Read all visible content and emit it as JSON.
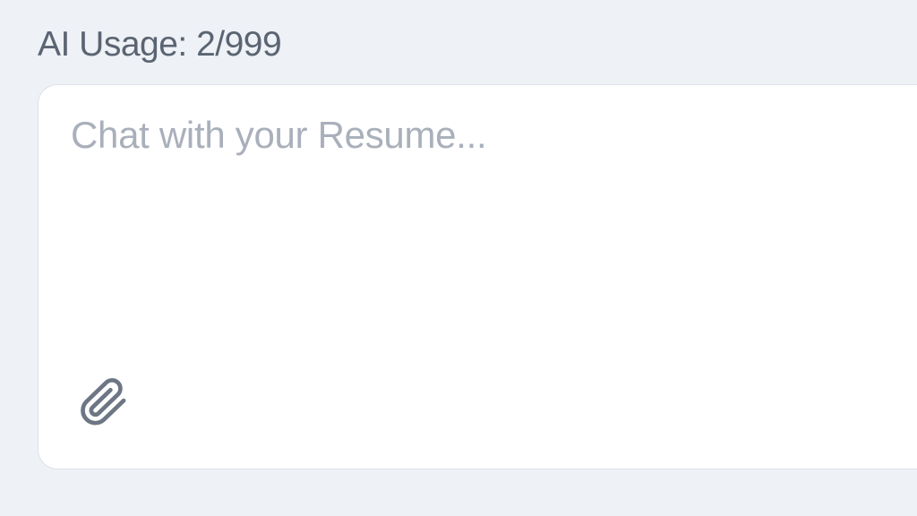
{
  "header": {
    "usage_label": "AI Usage: 2/999"
  },
  "chat": {
    "placeholder": "Chat with your Resume...",
    "value": ""
  }
}
